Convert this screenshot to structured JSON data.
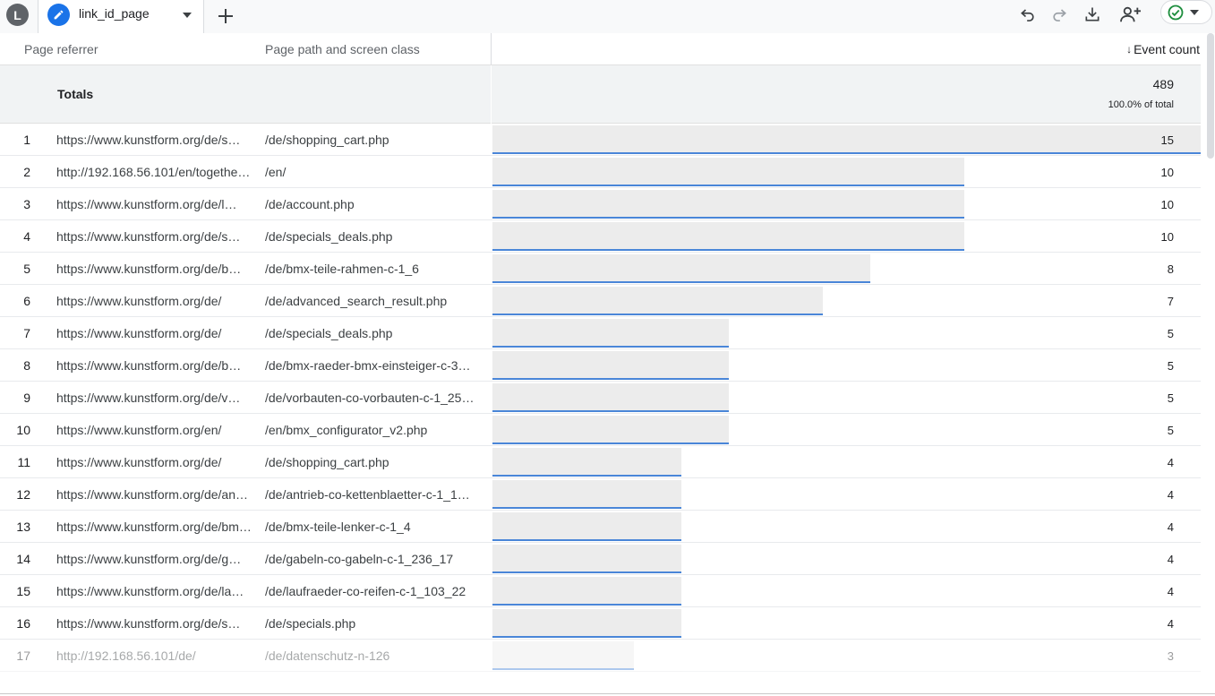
{
  "tab": {
    "avatar_letter": "L",
    "name": "link_id_page"
  },
  "accent": "#1a73e8",
  "bar_color": "#4a86d8",
  "columns": {
    "referrer": "Page referrer",
    "path": "Page path and screen class",
    "metric": "Event count",
    "sort_icon": "↓"
  },
  "totals": {
    "label": "Totals",
    "value": "489",
    "percent": "100.0% of total"
  },
  "max_count": 15,
  "rows": [
    {
      "idx": "1",
      "ref": "https://www.kunstform.org/de/s…",
      "path": "/de/shopping_cart.php",
      "count": "15",
      "value": 15
    },
    {
      "idx": "2",
      "ref": "http://192.168.56.101/en/togethe…",
      "path": "/en/",
      "count": "10",
      "value": 10
    },
    {
      "idx": "3",
      "ref": "https://www.kunstform.org/de/l…",
      "path": "/de/account.php",
      "count": "10",
      "value": 10
    },
    {
      "idx": "4",
      "ref": "https://www.kunstform.org/de/s…",
      "path": "/de/specials_deals.php",
      "count": "10",
      "value": 10
    },
    {
      "idx": "5",
      "ref": "https://www.kunstform.org/de/b…",
      "path": "/de/bmx-teile-rahmen-c-1_6",
      "count": "8",
      "value": 8
    },
    {
      "idx": "6",
      "ref": "https://www.kunstform.org/de/",
      "path": "/de/advanced_search_result.php",
      "count": "7",
      "value": 7
    },
    {
      "idx": "7",
      "ref": "https://www.kunstform.org/de/",
      "path": "/de/specials_deals.php",
      "count": "5",
      "value": 5
    },
    {
      "idx": "8",
      "ref": "https://www.kunstform.org/de/b…",
      "path": "/de/bmx-raeder-bmx-einsteiger-c-30…",
      "count": "5",
      "value": 5
    },
    {
      "idx": "9",
      "ref": "https://www.kunstform.org/de/v…",
      "path": "/de/vorbauten-co-vorbauten-c-1_25…",
      "count": "5",
      "value": 5
    },
    {
      "idx": "10",
      "ref": "https://www.kunstform.org/en/",
      "path": "/en/bmx_configurator_v2.php",
      "count": "5",
      "value": 5
    },
    {
      "idx": "11",
      "ref": "https://www.kunstform.org/de/",
      "path": "/de/shopping_cart.php",
      "count": "4",
      "value": 4
    },
    {
      "idx": "12",
      "ref": "https://www.kunstform.org/de/an…",
      "path": "/de/antrieb-co-kettenblaetter-c-1_1…",
      "count": "4",
      "value": 4
    },
    {
      "idx": "13",
      "ref": "https://www.kunstform.org/de/bm…",
      "path": "/de/bmx-teile-lenker-c-1_4",
      "count": "4",
      "value": 4
    },
    {
      "idx": "14",
      "ref": "https://www.kunstform.org/de/g…",
      "path": "/de/gabeln-co-gabeln-c-1_236_17",
      "count": "4",
      "value": 4
    },
    {
      "idx": "15",
      "ref": "https://www.kunstform.org/de/la…",
      "path": "/de/laufraeder-co-reifen-c-1_103_22",
      "count": "4",
      "value": 4
    },
    {
      "idx": "16",
      "ref": "https://www.kunstform.org/de/s…",
      "path": "/de/specials.php",
      "count": "4",
      "value": 4
    },
    {
      "idx": "17",
      "ref": "http://192.168.56.101/de/",
      "path": "/de/datenschutz-n-126",
      "count": "3",
      "value": 3
    }
  ]
}
